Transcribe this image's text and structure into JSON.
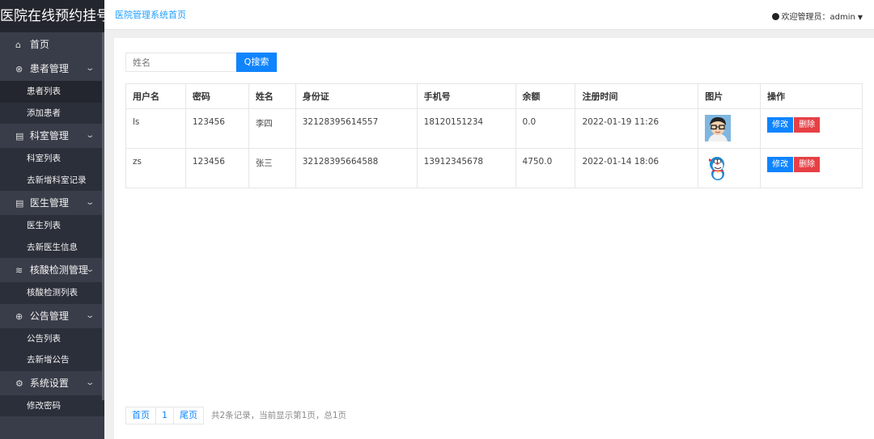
{
  "brand": "医院在线预约挂号",
  "breadcrumb": "医院管理系统首页",
  "user": {
    "label": "欢迎管理员：admin"
  },
  "sidebar": {
    "home": "首页",
    "groups": [
      {
        "label": "患者管理",
        "icon": "circle-user-icon",
        "items": [
          "患者列表",
          "添加患者"
        ]
      },
      {
        "label": "科室管理",
        "icon": "document-icon",
        "items": [
          "科室列表",
          "去新增科室记录"
        ]
      },
      {
        "label": "医生管理",
        "icon": "document-icon",
        "items": [
          "医生列表",
          "去新医生信息"
        ]
      },
      {
        "label": "核酸检测管理",
        "icon": "layers-icon",
        "items": [
          "核酸检测列表"
        ]
      },
      {
        "label": "公告管理",
        "icon": "megaphone-icon",
        "items": [
          "公告列表",
          "去新增公告"
        ]
      },
      {
        "label": "系统设置",
        "icon": "gear-icon",
        "items": [
          "修改密码"
        ]
      }
    ]
  },
  "search": {
    "placeholder": "姓名",
    "button": "Q搜索"
  },
  "table": {
    "headers": [
      "用户名",
      "密码",
      "姓名",
      "身份证",
      "手机号",
      "余额",
      "注册时间",
      "图片",
      "操作"
    ],
    "rows": [
      {
        "username": "ls",
        "password": "123456",
        "name": "李四",
        "id_card": "32128395614557",
        "phone": "18120151234",
        "balance": "0.0",
        "registered": "2022-01-19 11:26",
        "image": "avatar-boy-glasses"
      },
      {
        "username": "zs",
        "password": "123456",
        "name": "张三",
        "id_card": "32128395664588",
        "phone": "13912345678",
        "balance": "4750.0",
        "registered": "2022-01-14 18:06",
        "image": "avatar-doraemon"
      }
    ],
    "edit_label": "修改",
    "delete_label": "删除"
  },
  "pager": {
    "first": "首页",
    "current": "1",
    "last": "尾页",
    "info": "共2条记录，当前显示第1页，总1页"
  },
  "colors": {
    "sidebar": "#393d49",
    "brand_bg": "#23262e",
    "primary": "#0f84ff",
    "danger": "#e64045"
  }
}
